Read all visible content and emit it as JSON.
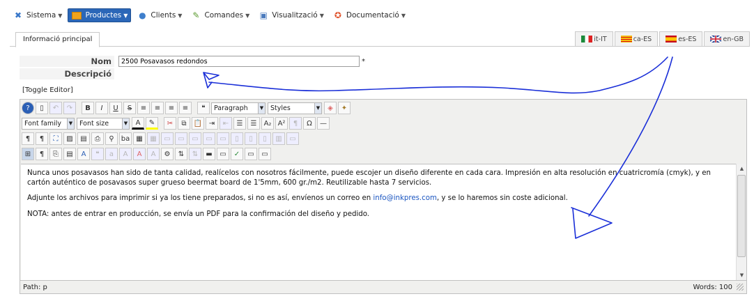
{
  "menu": [
    {
      "label": "Sistema",
      "icon": "tools-icon",
      "color": "#3a78c9"
    },
    {
      "label": "Productes",
      "icon": "folder-icon",
      "color": "#f0a31c",
      "active": true
    },
    {
      "label": "Clients",
      "icon": "user-icon",
      "color": "#3f7fcc"
    },
    {
      "label": "Comandes",
      "icon": "cart-icon",
      "color": "#5b9a2f"
    },
    {
      "label": "Visualització",
      "icon": "monitor-icon",
      "color": "#4a7abd"
    },
    {
      "label": "Documentació",
      "icon": "lifebuoy-icon",
      "color": "#e0532b"
    }
  ],
  "tabs": {
    "main": "Informació principal",
    "languages": [
      "it-IT",
      "ca-ES",
      "es-ES",
      "en-GB"
    ]
  },
  "form": {
    "name_label": "Nom",
    "name_value": "2500 Posavasos redondos",
    "required": "*",
    "description_label": "Descripció"
  },
  "toggle_editor": "[Toggle Editor]",
  "toolbar": {
    "format_select": "Paragraph",
    "styles_select": "Styles",
    "font_family": "Font family",
    "font_size": "Font size"
  },
  "content": {
    "p1": "Nunca unos posavasos han sido de tanta calidad, realícelos con nosotros fácilmente, puede escojer un diseño diferente en cada cara. Impresión en alta resolución en cuatricromía (cmyk), y en cartón auténtico de posavasos super grueso beermat board de 1'5mm, 600 gr./m2. Reutilizable hasta 7 servicios.",
    "p2_before": "Adjunte los archivos para imprimir si ya los tiene preparados, si no es así, envíenos un correo en ",
    "p2_link": "info@inkpres.com",
    "p2_after": ", y se lo haremos sin coste adicional.",
    "p3": "NOTA: antes de entrar en producción, se envía un PDF para la confirmación del diseño y pedido."
  },
  "status": {
    "path": "Path: p",
    "words": "Words: 100"
  },
  "colors": {
    "active_menu": "#2b67b8",
    "link": "#1a55c0",
    "annotation": "#1a2fd8"
  }
}
